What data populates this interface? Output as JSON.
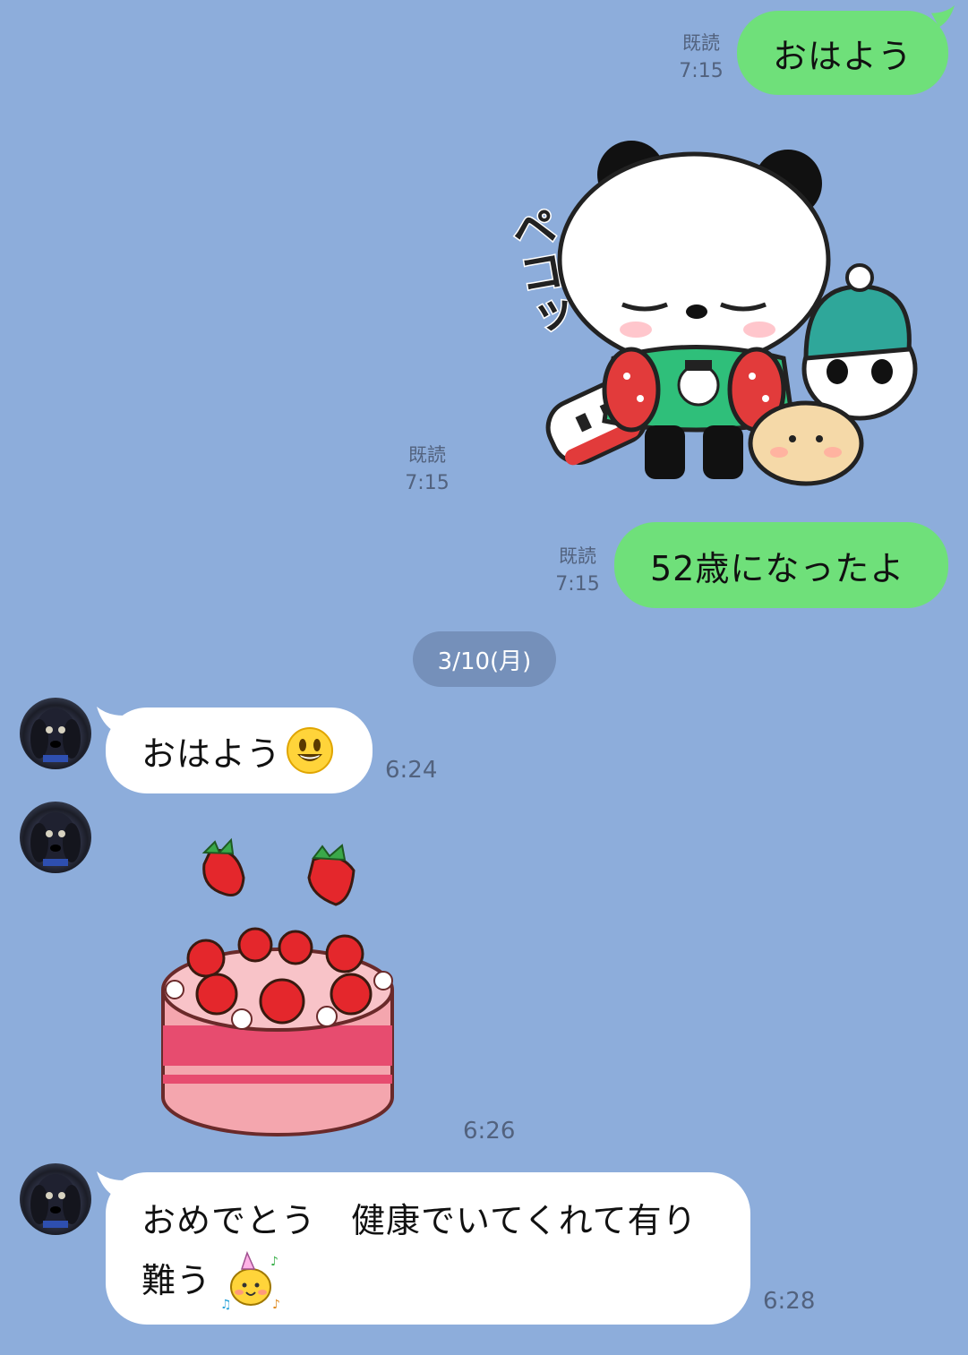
{
  "messages": {
    "m1": {
      "text": "おはよう",
      "read": "既読",
      "time": "7:15"
    },
    "m2": {
      "sticker_text": "ペコッ",
      "sticker": "panda-bow-sticker",
      "read": "既読",
      "time": "7:15"
    },
    "m3": {
      "text": "52歳になったよ",
      "read": "既読",
      "time": "7:15"
    }
  },
  "date_separator": "3/10(月)",
  "received": {
    "r1": {
      "text": "おはよう",
      "emoji": "smiley-face-emoji",
      "time": "6:24"
    },
    "r2": {
      "sticker": "strawberry-cake-sticker",
      "time": "6:26"
    },
    "r3": {
      "line1": "おめでとう　健康でいてくれて有り",
      "line2": "難う",
      "emoji": "party-character-emoji",
      "time": "6:28"
    }
  },
  "colors": {
    "background": "#8daddb",
    "sent_bubble": "#6fe07a",
    "received_bubble": "#ffffff",
    "date_pill": "#7590ba",
    "meta_text": "#52627e"
  }
}
